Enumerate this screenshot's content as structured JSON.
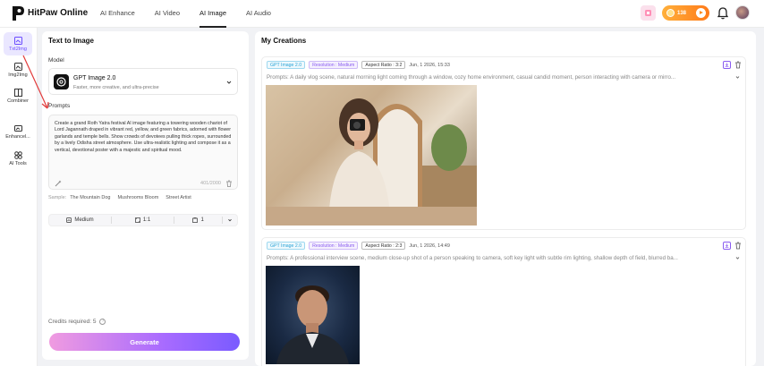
{
  "header": {
    "brand": "HitPaw Online",
    "nav": [
      "AI Enhance",
      "AI Video",
      "AI Image",
      "AI Audio"
    ],
    "active_nav": "AI Image",
    "credits_value": "138"
  },
  "sidebar": {
    "items": [
      {
        "label": "Txt2Img",
        "icon": "text-image-icon",
        "active": true
      },
      {
        "label": "Img2Img",
        "icon": "image-image-icon",
        "active": false
      },
      {
        "label": "Combiner",
        "icon": "combiner-icon",
        "active": false
      },
      {
        "label": "Enhancel...",
        "icon": "enhance-icon",
        "active": false
      },
      {
        "label": "AI Tools",
        "icon": "tools-icon",
        "active": false
      }
    ]
  },
  "left": {
    "title": "Text to Image",
    "model_label": "Model",
    "model_name": "GPT Image 2.0",
    "model_desc": "Faster, more creative, and ultra-precise",
    "prompts_label": "Prompts",
    "prompt_text": "Create a grand Roth Yatra festival AI image featuring a towering wooden chariot of Lord Jagannath draped in vibrant red, yellow, and green fabrics, adorned with flower garlands and temple bells. Show crowds of devotees pulling thick ropes, surrounded by a lively Odisha street atmosphere. Use ultra-realistic lighting and compose it as a vertical, devotional poster with a majestic and spiritual mood.",
    "char_count": "401/2000",
    "sample_label": "Sample:",
    "samples": [
      "The Mountain Dog",
      "Mushrooms Bloom",
      "Street Artist"
    ],
    "options": {
      "quality": "Medium",
      "ratio": "1:1",
      "count": "1"
    },
    "credits_required": "Credits required: 5",
    "generate_label": "Generate"
  },
  "right": {
    "title": "My Creations",
    "cards": [
      {
        "model": "GPT Image 2.0",
        "resolution": "Resolution : Medium",
        "aspect": "Aspect Ratio : 3:2",
        "date": "Jun, 1 2026, 15:33",
        "prompt": "Prompts: A daily vlog scene, natural morning light coming through a window, cozy home environment, casual candid moment, person interacting with camera or mirro..."
      },
      {
        "model": "GPT Image 2.0",
        "resolution": "Resolution : Medium",
        "aspect": "Aspect Ratio : 2:3",
        "date": "Jun, 1 2026, 14:49",
        "prompt": "Prompts: A professional interview scene, medium close-up shot of a person speaking to camera, soft key light with subtle rim lighting, shallow depth of field, blurred ba..."
      }
    ]
  },
  "colors": {
    "accent": "#7a5bff",
    "active_bg": "#eae7ff",
    "credits_pill": "#ff8a1a"
  }
}
